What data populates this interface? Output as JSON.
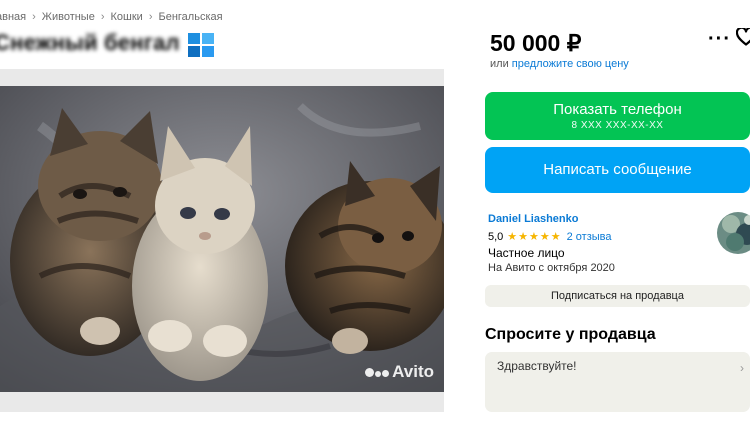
{
  "breadcrumb": {
    "items": [
      "авная",
      "Животные",
      "Кошки",
      "Бенгальская"
    ],
    "separator": "›"
  },
  "listing": {
    "title": "Снежный бенгал"
  },
  "gallery": {
    "watermark": "Avito"
  },
  "price": {
    "amount": "50 000 ₽",
    "or_text": "или ",
    "offer_link": "предложите свою цену"
  },
  "actions": {
    "more": "···"
  },
  "buttons": {
    "phone_label": "Показать телефон",
    "phone_mask": "8 XXX XXX-XX-XX",
    "message_label": "Написать сообщение"
  },
  "seller": {
    "name": "Daniel Liashenko",
    "rating": "5,0",
    "stars": "★★★★★",
    "reviews": "2 отзыва",
    "type": "Частное лицо",
    "since": "На Авито с октября 2020",
    "subscribe_label": "Подписаться на продавца"
  },
  "ask": {
    "title": "Спросите у продавца",
    "input_value": "Здравствуйте!"
  },
  "colors": {
    "phone_button": "#03c454",
    "message_button": "#00a3f5",
    "link": "#0a7ad5",
    "stars": "#f6b500"
  }
}
